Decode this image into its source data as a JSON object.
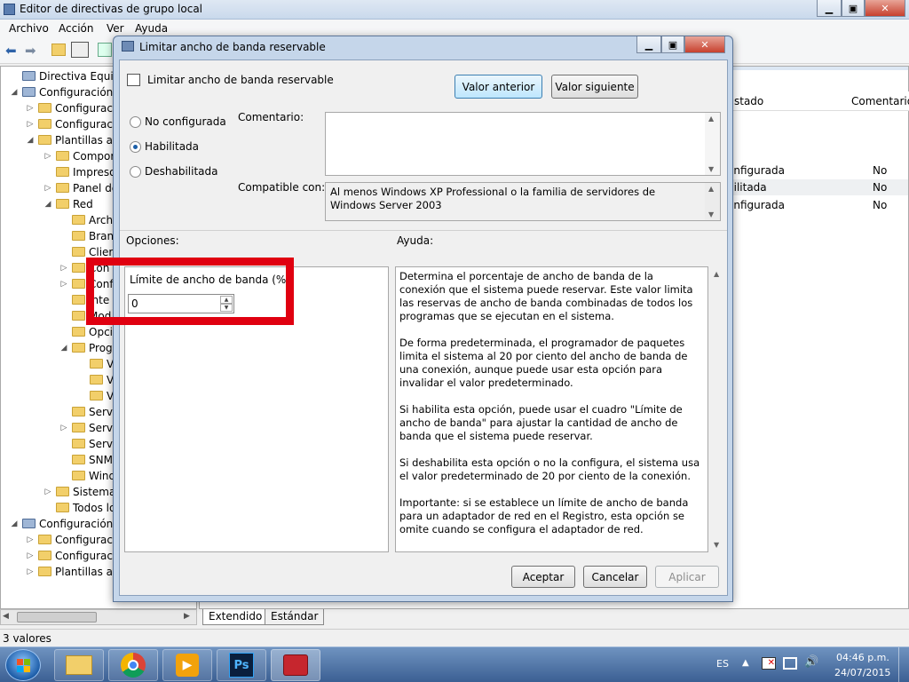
{
  "main_window": {
    "title": "Editor de directivas de grupo local",
    "menu": [
      "Archivo",
      "Acción",
      "Ver",
      "Ayuda"
    ],
    "status": "3 valores"
  },
  "tree": [
    {
      "label": "Directiva Equipo lo",
      "level": 0,
      "twisty": ""
    },
    {
      "label": "Configuración c",
      "level": 0,
      "twisty": "◢"
    },
    {
      "label": "Configuraci",
      "level": 1,
      "twisty": "▷"
    },
    {
      "label": "Configuraci",
      "level": 1,
      "twisty": "▷"
    },
    {
      "label": "Plantillas ad",
      "level": 1,
      "twisty": "◢"
    },
    {
      "label": "Compor",
      "level": 2,
      "twisty": "▷"
    },
    {
      "label": "Impreso",
      "level": 2,
      "twisty": ""
    },
    {
      "label": "Panel de",
      "level": 2,
      "twisty": "▷"
    },
    {
      "label": "Red",
      "level": 2,
      "twisty": "◢"
    },
    {
      "label": "Arch",
      "level": 3,
      "twisty": ""
    },
    {
      "label": "Bran",
      "level": 3,
      "twisty": ""
    },
    {
      "label": "Clier",
      "level": 3,
      "twisty": ""
    },
    {
      "label": "Con",
      "level": 3,
      "twisty": "▷"
    },
    {
      "label": "Conf",
      "level": 3,
      "twisty": "▷"
    },
    {
      "label": "Inte",
      "level": 3,
      "twisty": ""
    },
    {
      "label": "Mod",
      "level": 3,
      "twisty": ""
    },
    {
      "label": "Opci",
      "level": 3,
      "twisty": ""
    },
    {
      "label": "Prog",
      "level": 3,
      "twisty": "◢"
    },
    {
      "label": "V",
      "level": 4,
      "twisty": ""
    },
    {
      "label": "V",
      "level": 4,
      "twisty": ""
    },
    {
      "label": "V",
      "level": 4,
      "twisty": ""
    },
    {
      "label": "Servi",
      "level": 3,
      "twisty": ""
    },
    {
      "label": "Servi",
      "level": 3,
      "twisty": "▷"
    },
    {
      "label": "Servi",
      "level": 3,
      "twisty": ""
    },
    {
      "label": "SNM",
      "level": 3,
      "twisty": ""
    },
    {
      "label": "Wind",
      "level": 3,
      "twisty": ""
    },
    {
      "label": "Sistema",
      "level": 2,
      "twisty": "▷"
    },
    {
      "label": "Todos lo",
      "level": 2,
      "twisty": ""
    },
    {
      "label": "Configuración c",
      "level": 0,
      "twisty": "◢"
    },
    {
      "label": "Configuraci",
      "level": 1,
      "twisty": "▷"
    },
    {
      "label": "Configuraci",
      "level": 1,
      "twisty": "▷"
    },
    {
      "label": "Plantillas ad",
      "level": 1,
      "twisty": "▷"
    }
  ],
  "right_pane": {
    "col_estado": "stado",
    "col_comentario": "Comentario",
    "rows": [
      {
        "estado": "onfigurada",
        "comentario": "No"
      },
      {
        "estado": "bilitada",
        "comentario": "No"
      },
      {
        "estado": "onfigurada",
        "comentario": "No"
      }
    ]
  },
  "tabs": [
    "Extendido",
    "Estándar"
  ],
  "dialog": {
    "title": "Limitar ancho de banda reservable",
    "policy_name": "Limitar ancho de banda reservable",
    "prev_button": "Valor anterior",
    "next_button": "Valor siguiente",
    "radio_not_configured": "No configurada",
    "radio_enabled": "Habilitada",
    "radio_disabled": "Deshabilitada",
    "selected": "Habilitada",
    "comment_label": "Comentario:",
    "comment_value": "",
    "compatible_label": "Compatible con:",
    "compatible_value": "Al menos Windows XP Professional o la familia de servidores de Windows Server 2003",
    "options_label": "Opciones:",
    "help_label": "Ayuda:",
    "bandwidth_label": "Límite de ancho de banda (%):",
    "bandwidth_value": "0",
    "help_paragraphs": [
      "Determina el porcentaje de ancho de banda de la conexión que el sistema puede reservar. Este valor limita las reservas de ancho de banda combinadas de todos los programas que se ejecutan en el sistema.",
      "De forma predeterminada, el programador de paquetes limita el sistema al 20 por ciento del ancho de banda de una conexión, aunque puede usar esta opción para invalidar el valor predeterminado.",
      "Si habilita esta opción, puede usar el cuadro \"Límite de ancho de banda\" para ajustar la cantidad de ancho de banda que el sistema puede reservar.",
      "Si deshabilita esta opción o no la configura, el sistema usa el valor predeterminado de 20 por ciento de la conexión.",
      "Importante: si se establece un límite de ancho de banda para un adaptador de red en el Registro, esta opción se omite cuando se configura el adaptador de red."
    ],
    "ok_button": "Aceptar",
    "cancel_button": "Cancelar",
    "apply_button": "Aplicar"
  },
  "taskbar": {
    "language": "ES",
    "time": "04:46 p.m.",
    "date": "24/07/2015",
    "ps_label": "Ps"
  },
  "colors": {
    "highlight_box": "#e00010",
    "taskbar": "#3b5f93"
  }
}
